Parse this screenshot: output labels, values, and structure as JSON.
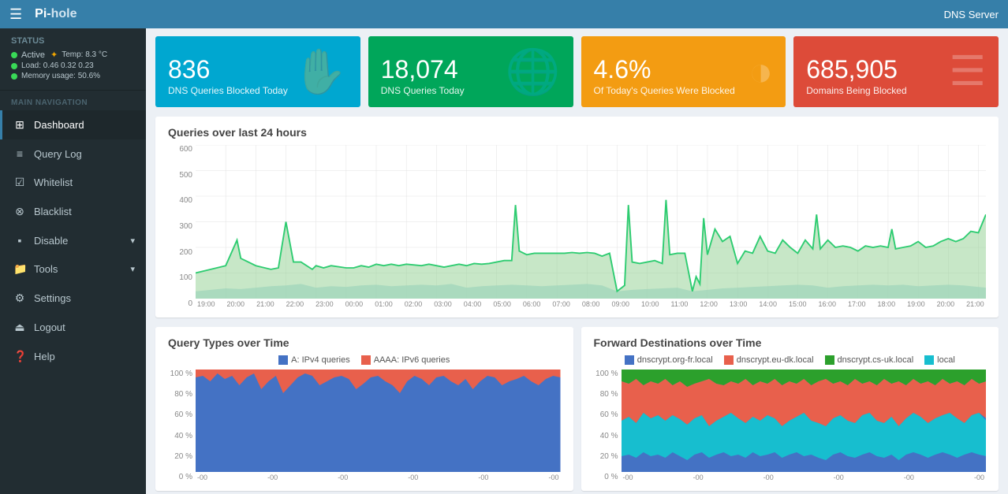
{
  "header": {
    "logo": "Pi-hole",
    "logo_prefix": "Pi-",
    "logo_suffix": "hole",
    "right_label": "DNS Server"
  },
  "sidebar": {
    "status_title": "Status",
    "status_items": [
      {
        "label": "Active",
        "dot": "green",
        "extra": "✦ Temp: 8.3 °C"
      },
      {
        "label": "Load: 0.46  0.32  0.23",
        "dot": "green"
      },
      {
        "label": "Memory usage: 50.6%",
        "dot": "green"
      }
    ],
    "nav_label": "MAIN NAVIGATION",
    "nav_items": [
      {
        "icon": "⊞",
        "label": "Dashboard",
        "active": true
      },
      {
        "icon": "≡",
        "label": "Query Log",
        "active": false
      },
      {
        "icon": "☑",
        "label": "Whitelist",
        "active": false
      },
      {
        "icon": "⊗",
        "label": "Blacklist",
        "active": false
      },
      {
        "icon": "⬛",
        "label": "Disable",
        "active": false,
        "expand": true
      },
      {
        "icon": "📁",
        "label": "Tools",
        "active": false,
        "expand": true
      },
      {
        "icon": "⚙",
        "label": "Settings",
        "active": false
      },
      {
        "icon": "⏏",
        "label": "Logout",
        "active": false
      },
      {
        "icon": "?",
        "label": "Help",
        "active": false
      }
    ]
  },
  "stat_cards": [
    {
      "number": "836",
      "label": "DNS Queries Blocked Today",
      "color": "blue",
      "icon": "✋"
    },
    {
      "number": "18,074",
      "label": "DNS Queries Today",
      "color": "green",
      "icon": "🌐"
    },
    {
      "number": "4.6%",
      "label": "Of Today's Queries Were Blocked",
      "color": "yellow",
      "icon": "◑"
    },
    {
      "number": "685,905",
      "label": "Domains Being Blocked",
      "color": "red",
      "icon": "☰"
    }
  ],
  "main_chart": {
    "title": "Queries over last 24 hours",
    "y_labels": [
      "600",
      "500",
      "400",
      "300",
      "200",
      "100",
      "0"
    ],
    "x_labels": [
      "19:00",
      "20:00",
      "21:00",
      "22:00",
      "23:00",
      "00:00",
      "01:00",
      "02:00",
      "03:00",
      "04:00",
      "05:00",
      "06:00",
      "07:00",
      "08:00",
      "09:00",
      "10:00",
      "11:00",
      "12:00",
      "13:00",
      "14:00",
      "15:00",
      "16:00",
      "17:00",
      "18:00",
      "19:00",
      "20:00",
      "21:00"
    ]
  },
  "query_types_chart": {
    "title": "Query Types over Time",
    "legend": [
      {
        "color": "#4472c4",
        "label": "A: IPv4 queries"
      },
      {
        "color": "#e8604c",
        "label": "AAAA: IPv6 queries"
      }
    ],
    "y_labels": [
      "100 %",
      "80 %",
      "60 %",
      "40 %",
      "20 %",
      "0 %"
    ]
  },
  "forward_destinations_chart": {
    "title": "Forward Destinations over Time",
    "legend": [
      {
        "color": "#4472c4",
        "label": "dnscrypt.org-fr.local"
      },
      {
        "color": "#e8604c",
        "label": "dnscrypt.eu-dk.local"
      },
      {
        "color": "#2ca02c",
        "label": "dnscrypt.cs-uk.local"
      },
      {
        "color": "#17becf",
        "label": "local"
      }
    ],
    "y_labels": [
      "100 %",
      "80 %",
      "60 %",
      "40 %",
      "20 %",
      "0 %"
    ]
  }
}
